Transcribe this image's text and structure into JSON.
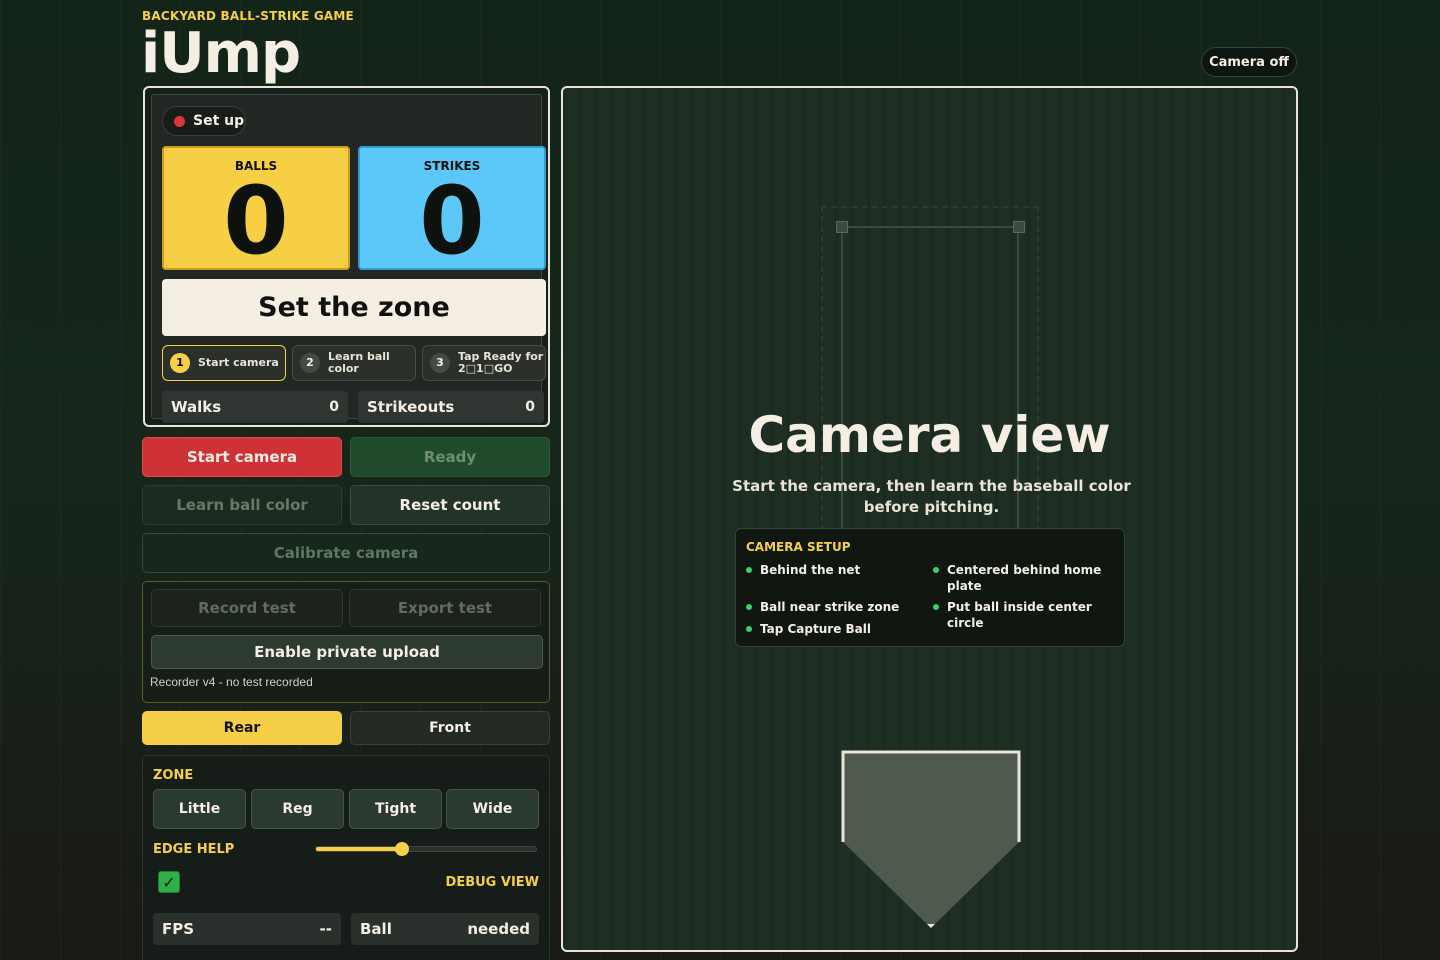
{
  "header": {
    "eyebrow": "BACKYARD BALL-STRIKE GAME",
    "title": "iUmp",
    "camera_status": "Camera off"
  },
  "scoreboard": {
    "status": "Set up",
    "balls_label": "BALLS",
    "balls": "0",
    "strikes_label": "STRIKES",
    "strikes": "0",
    "banner": "Set the zone",
    "steps": [
      {
        "n": "1",
        "label": "Start camera",
        "active": true
      },
      {
        "n": "2",
        "label": "Learn ball color",
        "active": false
      },
      {
        "n": "3",
        "label": "Tap Ready for 2□1□GO",
        "active": false
      }
    ],
    "walks_label": "Walks",
    "walks": "0",
    "strikeouts_label": "Strikeouts",
    "strikeouts": "0"
  },
  "controls": {
    "start_camera": "Start camera",
    "ready": "Ready",
    "learn_ball": "Learn ball color",
    "reset": "Reset count",
    "calibrate": "Calibrate camera",
    "record": "Record test",
    "export": "Export test",
    "upload": "Enable private upload",
    "recorder_note": "Recorder v4 - no test recorded",
    "rear": "Rear",
    "front": "Front"
  },
  "zone": {
    "label": "ZONE",
    "options": [
      "Little",
      "Reg",
      "Tight",
      "Wide"
    ],
    "edge_help_label": "EDGE HELP",
    "edge_help_value": 0.39,
    "debug_checked": true,
    "debug_label": "DEBUG VIEW",
    "fps_label": "FPS",
    "fps": "--",
    "ball_label": "Ball",
    "ball": "needed"
  },
  "camera": {
    "title": "Camera view",
    "subtitle": "Start the camera, then learn the baseball color before pitching.",
    "setup_heading": "CAMERA SETUP",
    "setup_items": [
      "Behind the net",
      "Centered behind home plate",
      "Ball near strike zone",
      "Put ball inside center circle",
      "Tap Capture Ball"
    ]
  },
  "colors": {
    "accent": "#f5cf45",
    "balls": "#f6cf45",
    "strikes": "#5cc8f7",
    "danger": "#cf3236",
    "ok": "#3bd06a"
  }
}
